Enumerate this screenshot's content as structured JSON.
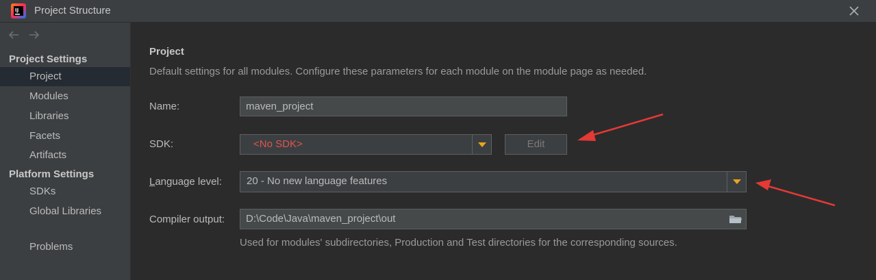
{
  "window": {
    "title": "Project Structure"
  },
  "sidebar": {
    "project_settings_header": "Project Settings",
    "platform_settings_header": "Platform Settings",
    "items": {
      "project": "Project",
      "modules": "Modules",
      "libraries": "Libraries",
      "facets": "Facets",
      "artifacts": "Artifacts",
      "sdks": "SDKs",
      "global_libraries": "Global Libraries",
      "problems": "Problems"
    },
    "selected": "Project"
  },
  "main": {
    "heading": "Project",
    "description": "Default settings for all modules. Configure these parameters for each module on the module page as needed.",
    "name": {
      "label": "Name:",
      "value": "maven_project"
    },
    "sdk": {
      "label": "SDK:",
      "value": "<No SDK>",
      "edit_label": "Edit"
    },
    "language_level": {
      "label_underlined": "L",
      "label_rest": "anguage level:",
      "value": "20 - No new language features"
    },
    "compiler_output": {
      "label": "Compiler output:",
      "value": "D:\\Code\\Java\\maven_project\\out",
      "hint": "Used for modules' subdirectories, Production and Test directories for the corresponding sources."
    }
  },
  "colors": {
    "background": "#2b2b2b",
    "sidebar": "#3c3f41",
    "selection": "#252b32",
    "error_text": "#e0544f",
    "dropdown_arrow": "#e8a51d",
    "annotation_arrow": "#e53935"
  },
  "icons": [
    "intellij-app-icon",
    "back-arrow-icon",
    "forward-arrow-icon",
    "close-icon",
    "dropdown-arrow-icon",
    "folder-icon"
  ]
}
